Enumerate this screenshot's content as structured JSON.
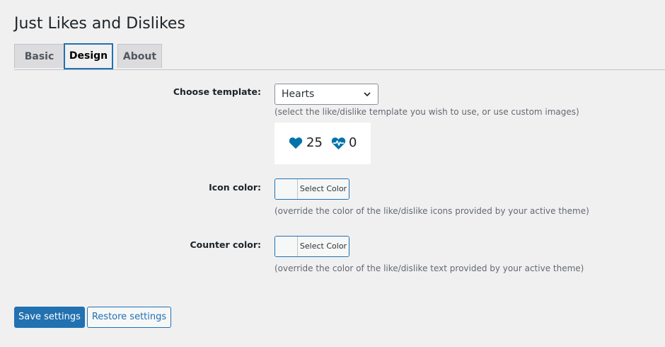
{
  "page": {
    "title": "Just Likes and Dislikes"
  },
  "tabs": [
    {
      "label": "Basic",
      "active": false
    },
    {
      "label": "Design",
      "active": true
    },
    {
      "label": "About",
      "active": false
    }
  ],
  "template": {
    "label": "Choose template:",
    "selected": "Hearts",
    "description": "(select the like/dislike template you wish to use, or use custom images)",
    "preview": {
      "like_icon": "heart-icon",
      "like_count": "25",
      "dislike_icon": "heart-pulse-icon",
      "dislike_count": "0",
      "icon_color": "#0073aa"
    }
  },
  "icon_color": {
    "label": "Icon color:",
    "button_label": "Select Color",
    "description": "(override the color of the like/dislike icons provided by your active theme)"
  },
  "counter_color": {
    "label": "Counter color:",
    "button_label": "Select Color",
    "description": "(override the color of the like/dislike text provided by your active theme)"
  },
  "actions": {
    "save_label": "Save settings",
    "restore_label": "Restore settings"
  },
  "colors": {
    "accent": "#2271b1",
    "background": "#f0f0f1"
  }
}
